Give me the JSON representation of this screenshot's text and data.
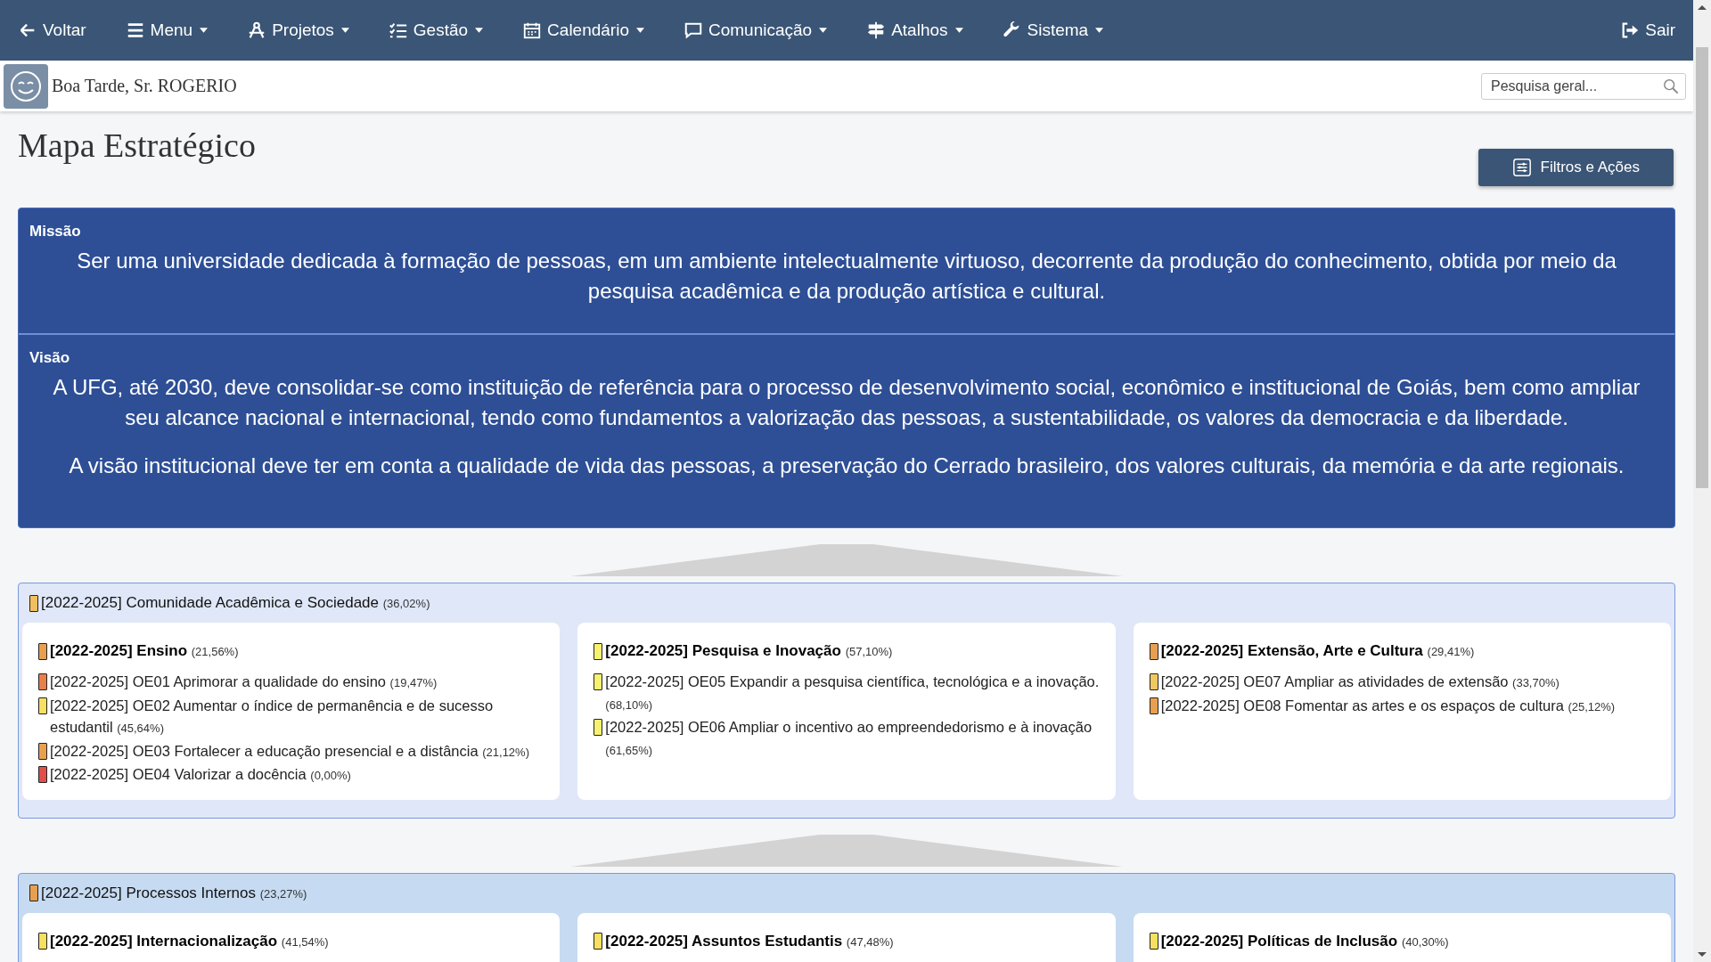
{
  "nav": {
    "back": "Voltar",
    "menus": [
      {
        "label": "Menu"
      },
      {
        "label": "Projetos"
      },
      {
        "label": "Gestão"
      },
      {
        "label": "Calendário"
      },
      {
        "label": "Comunicação"
      },
      {
        "label": "Atalhos"
      },
      {
        "label": "Sistema"
      }
    ],
    "exit": "Sair"
  },
  "header": {
    "greeting": "Boa Tarde, Sr. ROGERIO",
    "search": {
      "placeholder": "Pesquisa geral..."
    }
  },
  "page_title": "Mapa Estratégico",
  "filters_button": "Filtros e Ações",
  "statements": [
    {
      "heading": "Missão",
      "paragraphs": [
        "Ser uma universidade dedicada à formação de pessoas, em um ambiente intelectualmente virtuoso, decorrente da produção do conhecimento, obtida por meio da pesquisa acadêmica e da produção artística e cultural."
      ]
    },
    {
      "heading": "Visão",
      "paragraphs": [
        "A UFG, até 2030, deve consolidar-se como instituição de referência para o processo de desenvolvimento social, econômico e institucional de Goiás, bem como ampliar seu alcance nacional e internacional, tendo como fundamentos a valorização das pessoas, a sustentabilidade, os valores da democracia e da liberdade.",
        "A visão institucional deve ter em conta a  qualidade de vida das pessoas, a preservação do Cerrado brasileiro, dos valores culturais, da memória e da arte regionais."
      ]
    }
  ],
  "perspectives": [
    {
      "title": "[2022-2025] Comunidade Acadêmica e Sociedade",
      "percent": "(36,02%)",
      "color": "#f0c060",
      "themes": [
        {
          "title": "[2022-2025] Ensino",
          "percent": "(21,56%)",
          "color": "#e8a050",
          "objectives": [
            {
              "label": "[2022-2025] OE01 Aprimorar a qualidade do ensino",
              "percent": "(19,47%)",
              "color": "#e8804c"
            },
            {
              "label": "[2022-2025] OE02 Aumentar o índice de permanência e de sucesso estudantil",
              "percent": "(45,64%)",
              "color": "#f5e060"
            },
            {
              "label": "[2022-2025] OE03 Fortalecer a educação presencial e a distância",
              "percent": "(21,12%)",
              "color": "#e8a050"
            },
            {
              "label": "[2022-2025] OE04 Valorizar a docência",
              "percent": "(0,00%)",
              "color": "#e05048"
            }
          ]
        },
        {
          "title": "[2022-2025] Pesquisa e Inovação",
          "percent": "(57,10%)",
          "color": "#f8f070",
          "objectives": [
            {
              "label": "[2022-2025] OE05 Expandir a pesquisa científica, tecnológica e a inovação.",
              "percent": "(68,10%)",
              "color": "#f8f070"
            },
            {
              "label": "[2022-2025] OE06 Ampliar o incentivo ao empreendedorismo e à inovação",
              "percent": "(61,65%)",
              "color": "#f8f070"
            }
          ]
        },
        {
          "title": "[2022-2025] Extensão, Arte e Cultura",
          "percent": "(29,41%)",
          "color": "#e8a050",
          "objectives": [
            {
              "label": "[2022-2025] OE07 Ampliar as atividades de extensão",
              "percent": "(33,70%)",
              "color": "#f0c860"
            },
            {
              "label": "[2022-2025] OE08 Fomentar as artes e os espaços de cultura",
              "percent": "(25,12%)",
              "color": "#e8a050"
            }
          ]
        }
      ]
    },
    {
      "title": "[2022-2025] Processos Internos",
      "percent": "(23,27%)",
      "color": "#e8a050",
      "themes": [
        {
          "title": "[2022-2025] Internacionalização",
          "percent": "(41,54%)",
          "color": "#f5e060"
        },
        {
          "title": "[2022-2025] Assuntos Estudantis",
          "percent": "(47,48%)",
          "color": "#f5e060"
        },
        {
          "title": "[2022-2025] Políticas de Inclusão",
          "percent": "(40,30%)",
          "color": "#f5e060"
        }
      ]
    }
  ]
}
